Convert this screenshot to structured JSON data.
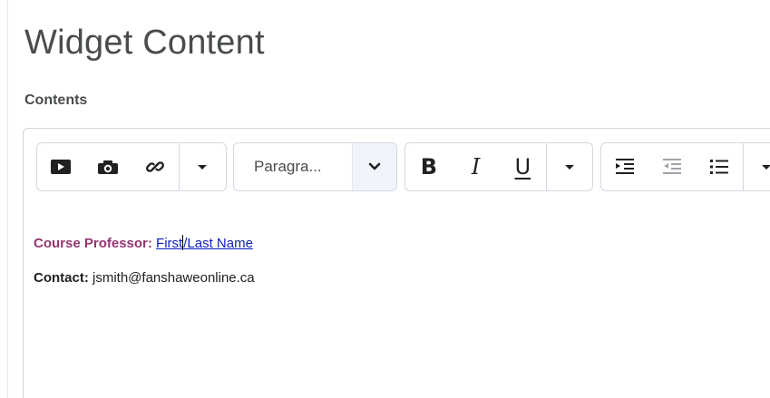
{
  "page": {
    "title": "Widget Content",
    "contents_label": "Contents"
  },
  "toolbar": {
    "insert_group": {
      "icons": [
        "insert-video-icon",
        "insert-image-icon",
        "insert-link-icon",
        "more-insert-chevron-icon"
      ]
    },
    "block_format": {
      "selected_label": "Paragra..."
    },
    "text_format": {
      "bold_glyph": "B",
      "italic_glyph": "I",
      "underline_glyph": "U"
    },
    "list_group": {
      "icons": [
        "indent-icon",
        "outdent-icon",
        "bullet-list-icon",
        "more-list-chevron-icon"
      ]
    }
  },
  "content": {
    "professor_label": "Course Professor:",
    "professor_link_part1": "First",
    "professor_link_part2": "/Last Name",
    "contact_label": "Contact:",
    "contact_value": "jsmith@fanshaweonline.ca"
  },
  "colors": {
    "professor_label": "#93366f",
    "link": "#0b1fc0",
    "text": "#494c4e",
    "border": "#cdd5dc"
  }
}
